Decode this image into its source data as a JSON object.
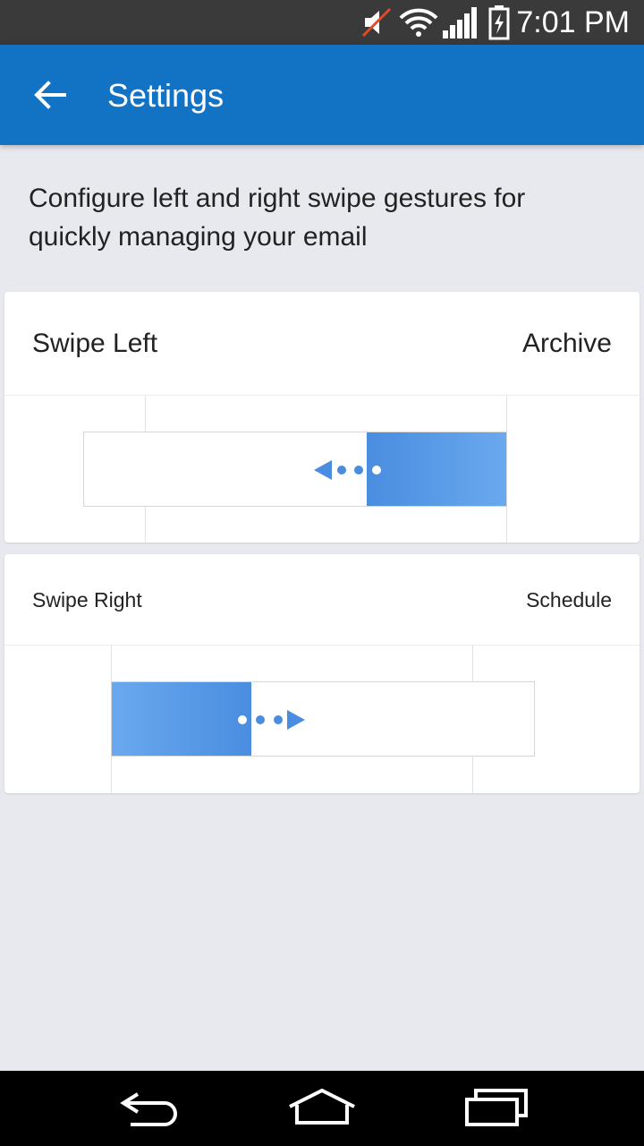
{
  "status_bar": {
    "time": "7:01 PM",
    "icons": [
      "mute-icon",
      "wifi-icon",
      "signal-icon",
      "battery-charging-icon"
    ]
  },
  "app_bar": {
    "title": "Settings",
    "back_icon": "arrow-left-icon",
    "color": "#1272c4"
  },
  "description": "Configure left and right swipe gestures for quickly managing your email",
  "swipe_left": {
    "label": "Swipe Left",
    "action": "Archive",
    "illustration_icon": "swipe-left-arrow-icon"
  },
  "swipe_right": {
    "label": "Swipe Right",
    "action": "Schedule",
    "illustration_icon": "swipe-right-arrow-icon"
  },
  "colors": {
    "accent": "#4a8de0",
    "accent_light": "#6aa9ee",
    "background": "#e8e9ee"
  },
  "nav_bar": {
    "icons": [
      "back-nav-icon",
      "home-nav-icon",
      "recent-apps-icon"
    ]
  }
}
